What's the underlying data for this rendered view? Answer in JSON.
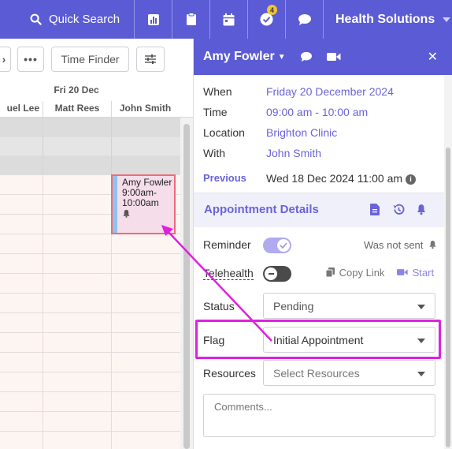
{
  "topnav": {
    "search_label": "Quick Search",
    "tasks_badge": "4",
    "org_label": "Health Solutions"
  },
  "toolbar": {
    "time_finder_label": "Time Finder"
  },
  "calendar": {
    "date_label": "Fri 20 Dec",
    "practitioners": [
      "uel Lee",
      "Matt Rees",
      "John Smith"
    ],
    "appointment": {
      "name": "Amy Fowler",
      "time": "9:00am-10:00am"
    }
  },
  "panel": {
    "patient_name": "Amy Fowler",
    "when_label": "When",
    "when_value": "Friday 20 December 2024",
    "time_label": "Time",
    "time_value": "09:00 am - 10:00 am",
    "location_label": "Location",
    "location_value": "Brighton Clinic",
    "with_label": "With",
    "with_value": "John Smith",
    "previous_label": "Previous",
    "previous_value": "Wed 18 Dec 2024 11:00 am",
    "section_title": "Appointment Details",
    "reminder_label": "Reminder",
    "reminder_status": "Was not sent",
    "telehealth_label": "Telehealth",
    "copy_link_label": "Copy Link",
    "start_label": "Start",
    "status_label": "Status",
    "status_value": "Pending",
    "flag_label": "Flag",
    "flag_value": "Initial Appointment",
    "resources_label": "Resources",
    "resources_placeholder": "Select Resources",
    "comments_placeholder": "Comments..."
  },
  "colors": {
    "brand": "#5b5bd6",
    "accent_text": "#6a64d8",
    "annotation": "#e020e0",
    "appointment_bg": "#f5dde9",
    "appointment_border": "#f06a7a"
  }
}
